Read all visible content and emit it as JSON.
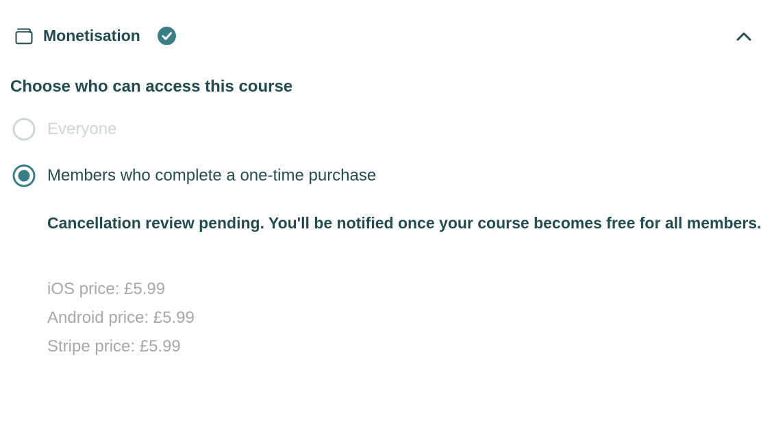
{
  "section": {
    "title": "Monetisation",
    "status": "complete",
    "expanded": true
  },
  "access": {
    "heading": "Choose who can access this course",
    "options": [
      {
        "label": "Everyone",
        "selected": false,
        "disabled": true
      },
      {
        "label": "Members who complete a one-time purchase",
        "selected": true,
        "disabled": false
      }
    ]
  },
  "notice": "Cancellation review pending. You'll be notified once your course becomes free for all members.",
  "prices": [
    "iOS price: £5.99",
    "Android price: £5.99",
    "Stripe price: £5.99"
  ],
  "colors": {
    "accent": "#3b7f86",
    "text_dark": "#234b52",
    "text_muted": "#a6a9ab",
    "disabled": "#cfd6d8"
  },
  "icons": {
    "section": "folder-icon",
    "status": "check-circle-icon",
    "toggle": "chevron-up-icon"
  }
}
